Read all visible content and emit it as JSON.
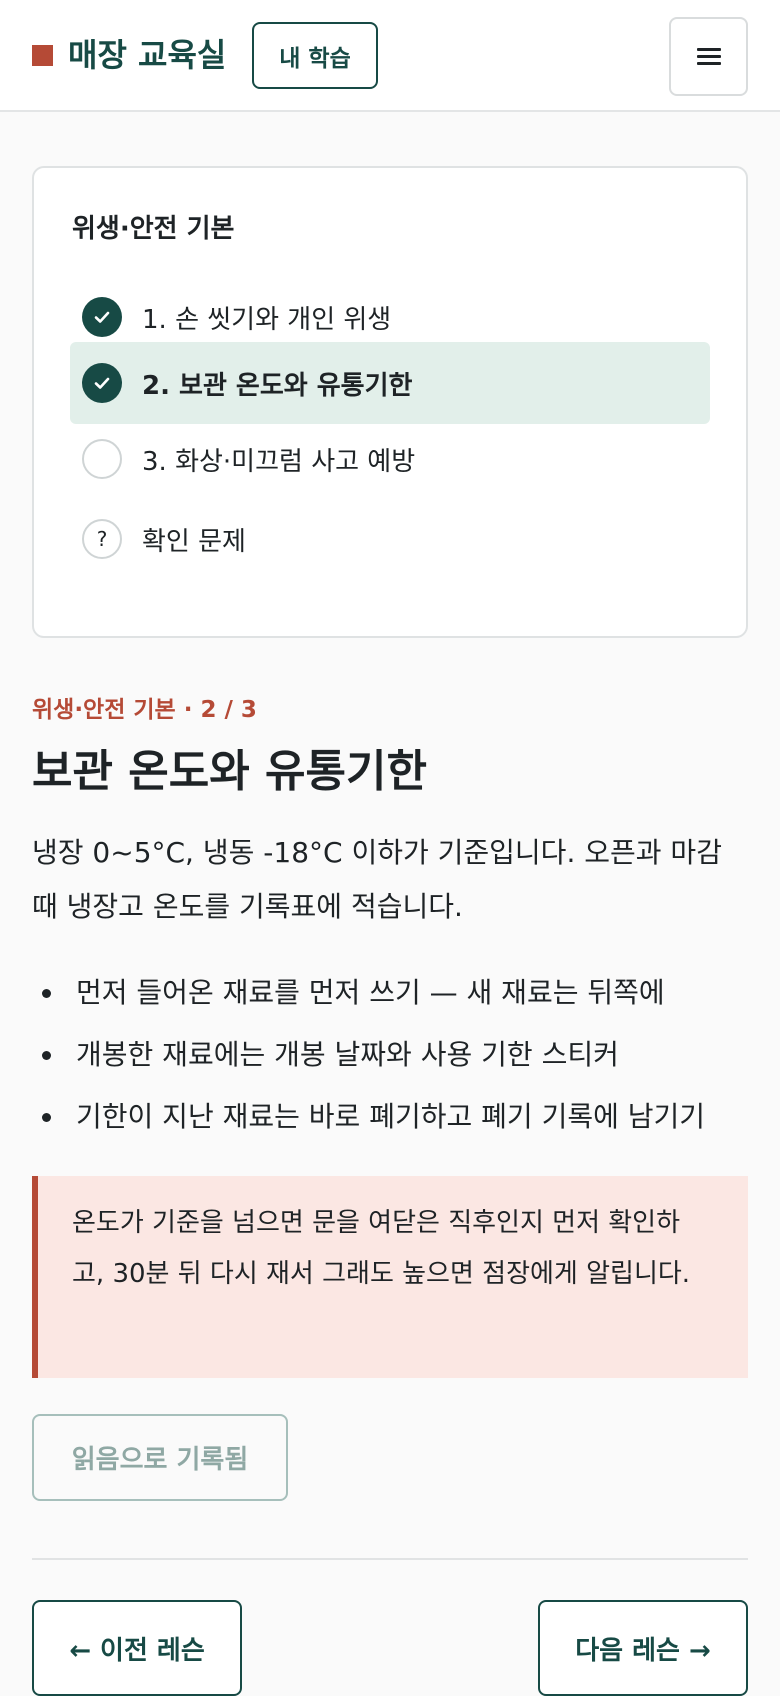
{
  "header": {
    "brand_title": "매장 교육실",
    "my_learning_label": "내 학습"
  },
  "course": {
    "title": "위생·안전 기본",
    "lessons": [
      {
        "label": "1. 손 씻기와 개인 위생",
        "status": "done"
      },
      {
        "label": "2. 보관 온도와 유통기한",
        "status": "done"
      },
      {
        "label": "3. 화상·미끄럼 사고 예방",
        "status": "todo"
      },
      {
        "label": "확인 문제",
        "status": "quiz",
        "icon_glyph": "?"
      }
    ]
  },
  "lesson": {
    "kicker": "위생·안전 기본 · 2 / 3",
    "title": "보관 온도와 유통기한",
    "intro": "냉장 0~5°C, 냉동 -18°C 이하가 기준입니다. 오픈과 마감 때 냉장고 온도를 기록표에 적습니다.",
    "points": [
      "먼저 들어온 재료를 먼저 쓰기 — 새 재료는 뒤쪽에",
      "개봉한 재료에는 개봉 날짜와 사용 기한 스티커",
      "기한이 지난 재료는 바로 폐기하고 폐기 기록에 남기기"
    ],
    "callout": "온도가 기준을 넘으면 문을 여닫은 직후인지 먼저 확인하고, 30분 뒤 다시 재서 그래도 높으면 점장에게 알립니다.",
    "read_status_label": "읽음으로 기록됨"
  },
  "nav": {
    "prev_label": "← 이전 레슨",
    "next_label": "다음 레슨 →"
  },
  "colors": {
    "brand": "#174a45",
    "accent": "#b54a36",
    "active_bg": "#e2efea",
    "callout_bg": "#fbe7e3"
  }
}
